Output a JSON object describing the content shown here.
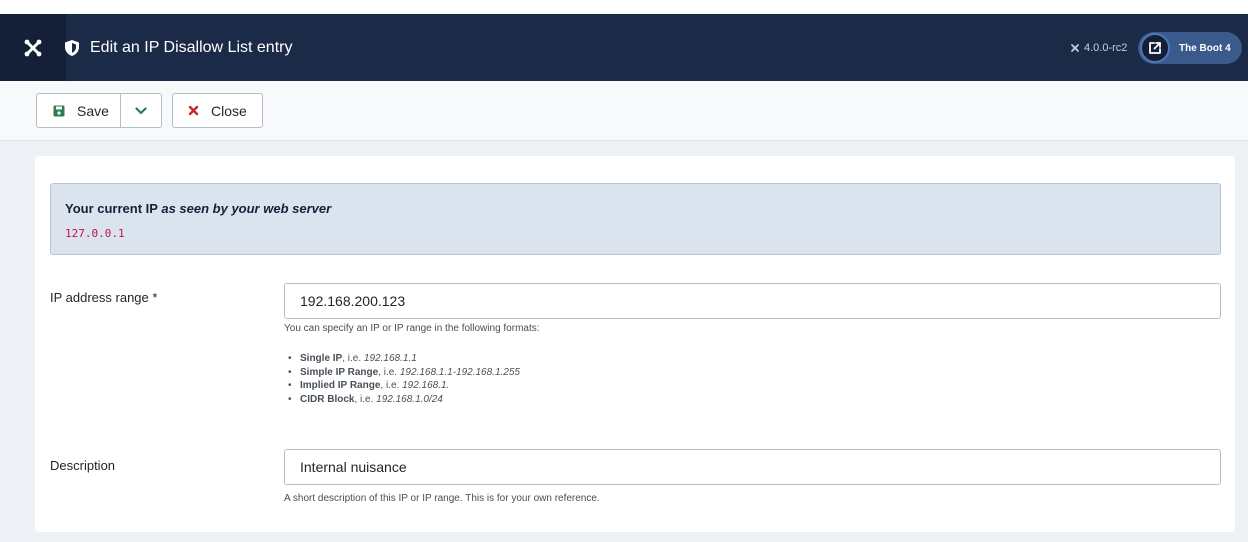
{
  "header": {
    "title": "Edit an IP Disallow List entry",
    "version": "4.0.0-rc2",
    "site_button_label": "The Boot 4"
  },
  "toolbar": {
    "save_label": "Save",
    "close_label": "Close"
  },
  "alert": {
    "heading_prefix": "Your current IP",
    "heading_suffix": "as seen by your web server",
    "ip": "127.0.0.1"
  },
  "form": {
    "ip_range": {
      "label": "IP address range *",
      "value": "192.168.200.123",
      "help": "You can specify an IP or IP range in the following formats:",
      "formats": [
        {
          "name": "Single IP",
          "sep": ", i.e. ",
          "example": "192.168.1.1"
        },
        {
          "name": "Simple IP Range",
          "sep": ", i.e. ",
          "example": "192.168.1.1-192.168.1.255"
        },
        {
          "name": "Implied IP Range",
          "sep": ", i.e. ",
          "example": "192.168.1."
        },
        {
          "name": "CIDR Block",
          "sep": ", i.e. ",
          "example": "192.168.1.0/24"
        }
      ]
    },
    "description": {
      "label": "Description",
      "value": "Internal nuisance",
      "help": "A short description of this IP or IP range. This is for your own reference."
    }
  },
  "colors": {
    "header_bg": "#1b2a47",
    "accent": "#3a5a8c",
    "save_icon": "#2e7d4f",
    "close_icon": "#c52827",
    "ip_text": "#c0144b"
  }
}
